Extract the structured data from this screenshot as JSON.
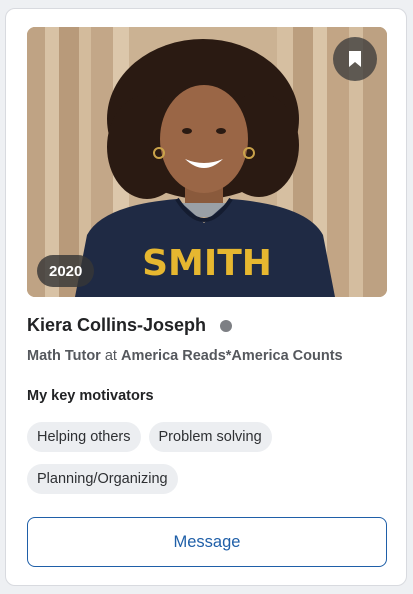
{
  "profile": {
    "name": "Kiera Collins-Joseph",
    "year": "2020",
    "role": "Math Tutor",
    "at": "at",
    "organization": "America Reads*America Counts",
    "status_color": "#7d7f84",
    "photo_description_icon": "profile-photo",
    "hoodie_text": "SMITH"
  },
  "motivators": {
    "heading": "My key motivators",
    "tags": [
      "Helping others",
      "Problem solving",
      "Planning/Organizing"
    ]
  },
  "actions": {
    "message_label": "Message",
    "bookmark_icon": "bookmark-icon"
  },
  "colors": {
    "accent": "#1f5fa8",
    "tag_bg": "#eceef1"
  }
}
